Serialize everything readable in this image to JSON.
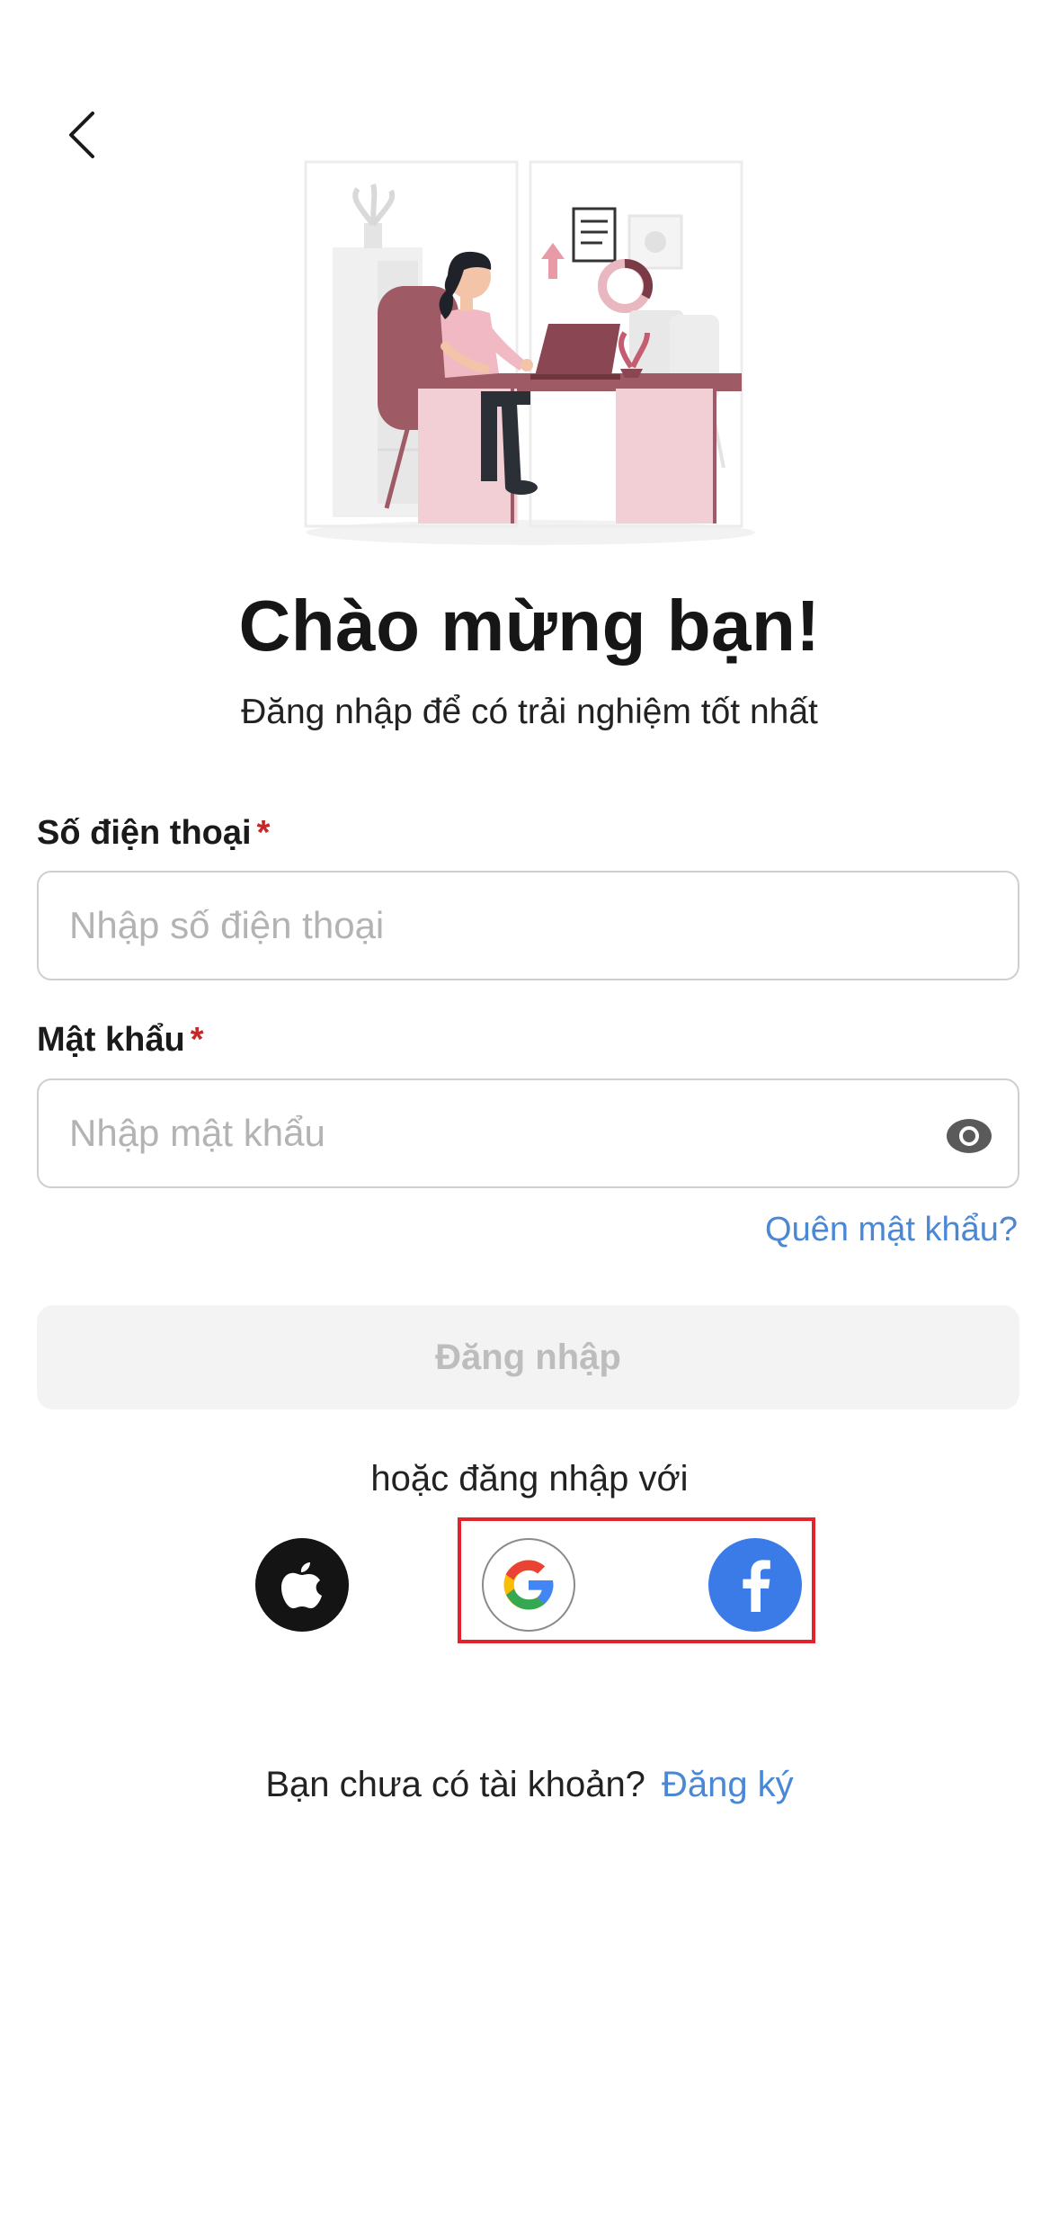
{
  "header": {
    "back_icon": "chevron-left-icon"
  },
  "illustration": {
    "name": "woman-at-desk-illustration"
  },
  "welcome": {
    "title": "Chào mừng bạn!",
    "subtitle": "Đăng nhập để có trải nghiệm tốt nhất"
  },
  "form": {
    "phone": {
      "label": "Số điện thoại",
      "required_mark": "*",
      "placeholder": "Nhập số điện thoại",
      "value": ""
    },
    "password": {
      "label": "Mật khẩu",
      "required_mark": "*",
      "placeholder": "Nhập mật khẩu",
      "value": "",
      "toggle_icon": "eye-icon"
    },
    "forgot_label": "Quên mật khẩu?",
    "login_label": "Đăng nhập"
  },
  "social": {
    "divider_text": "hoặc đăng nhập với",
    "providers": [
      "apple",
      "google",
      "facebook"
    ]
  },
  "footer": {
    "prompt": "Bạn chưa có tài khoản?",
    "signup_label": "Đăng ký"
  },
  "colors": {
    "accent_link": "#4a87d4",
    "required": "#c62828",
    "facebook": "#3b7be8",
    "highlight_box": "#e1242b",
    "disabled_button_bg": "#f3f3f3"
  }
}
